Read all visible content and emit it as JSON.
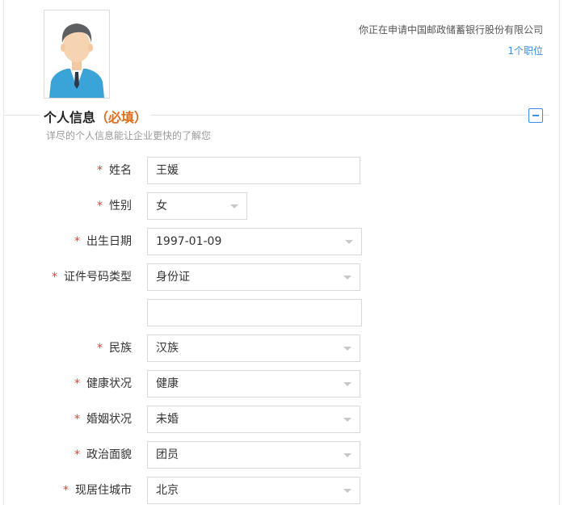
{
  "apply_info": {
    "company_text": "你正在申请中国邮政储蓄银行股份有限公司",
    "positions_link": "1个职位"
  },
  "section": {
    "title": "个人信息",
    "required_tag": "（必填）",
    "subtitle": "详尽的个人信息能让企业更快的了解您"
  },
  "form": {
    "required_mark": "*",
    "name": {
      "label": "姓名",
      "value": "王媛"
    },
    "gender": {
      "label": "性别",
      "value": "女"
    },
    "birth_date": {
      "label": "出生日期",
      "value": "1997-01-09"
    },
    "id_type": {
      "label": "证件号码类型",
      "value": "身份证"
    },
    "id_number": {
      "value": ""
    },
    "ethnicity": {
      "label": "民族",
      "value": "汉族"
    },
    "health": {
      "label": "健康状况",
      "value": "健康"
    },
    "marital": {
      "label": "婚姻状况",
      "value": "未婚"
    },
    "political": {
      "label": "政治面貌",
      "value": "团员"
    },
    "city": {
      "label": "现居住城市",
      "value": "北京"
    }
  },
  "colors": {
    "accent": "#3a8ee6",
    "required_star": "#e03c3c",
    "required_tag": "#e26c1c"
  }
}
